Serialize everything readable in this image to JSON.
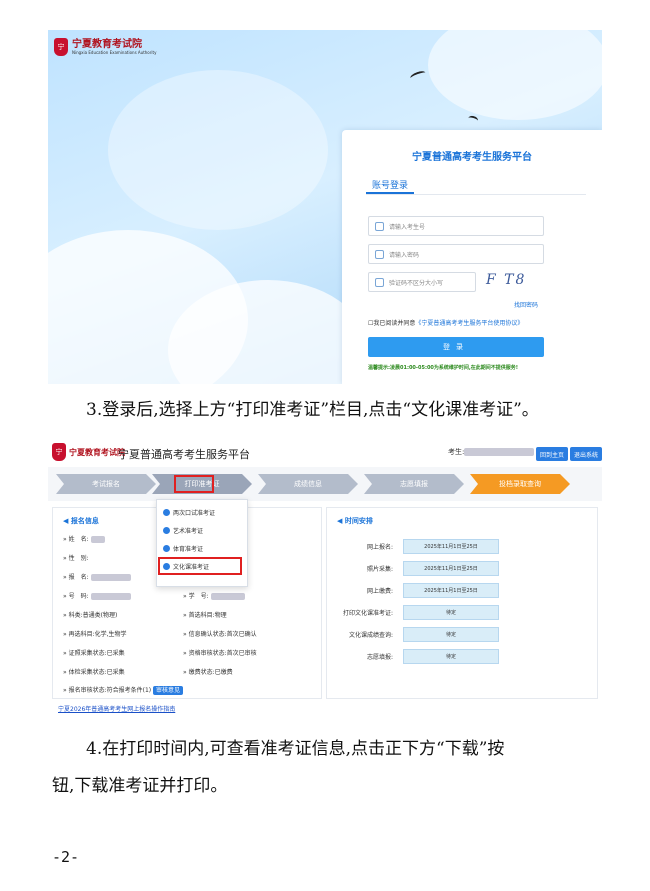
{
  "screenshot1": {
    "logo_text": "宁夏教育考试院",
    "logo_subtext": "Ningxia Education Examinations Authority",
    "login_title": "宁夏普通高考考生服务平台",
    "tab_label": "账号登录",
    "username_placeholder": "请输入考生号",
    "password_placeholder": "请输入密码",
    "captcha_placeholder": "验证码不区分大小写",
    "captcha_text": "F T8",
    "forgot_link": "找回密码",
    "agree_prefix": "我已阅读并同意",
    "agree_link": "《宁夏普通高考考生服务平台使用协议》",
    "login_button": "登录",
    "notice": "温馨提示:凌晨01:00-05:00为系统维护时间,在此期间不提供服务!"
  },
  "step3_text": "3.登录后,选择上方“打印准考证”栏目,点击“文化课准考证”。",
  "screenshot2": {
    "platform_title": "宁夏普通高考考生服务平台",
    "candidate_label": "考生:",
    "btn_home": "回到主页",
    "btn_logout": "退出系统",
    "steps": [
      "考试报名",
      "打印准考证",
      "成绩信息",
      "志愿填报",
      "投档录取查询"
    ],
    "dropdown_items": [
      "两次口试准考证",
      "艺术准考证",
      "体育准考证",
      "文化课准考证"
    ],
    "left_panel_title": "报名信息",
    "left_rows": [
      "姓　名:",
      "性　别:",
      "报　名:",
      "号　码:",
      "科类:普通类(物理)",
      "再选科目:化学,生物学",
      "证照采集状态:已采集",
      "体检采集状态:已采集",
      "报名审核状态:符合报考条件(1)"
    ],
    "left_rows_col2": [
      "学　号:",
      "首选科目:物理",
      "信息确认状态:首次已确认",
      "资格审核状态:首次已审核",
      "缴费状态:已缴费"
    ],
    "review_button": "审核意见",
    "right_panel_title": "时间安排",
    "time_rows": [
      {
        "label": "网上报名:",
        "value": "2025年11月1日至25日"
      },
      {
        "label": "照片采集:",
        "value": "2025年11月1日至25日"
      },
      {
        "label": "网上缴费:",
        "value": "2025年11月1日至25日"
      },
      {
        "label": "打印文化课准考证:",
        "value": "待定"
      },
      {
        "label": "文化课成绩查询:",
        "value": "待定"
      },
      {
        "label": "志愿填报:",
        "value": "待定"
      }
    ],
    "bottom_link": "宁夏2026年普通高考考生网上报名操作指南"
  },
  "step4_line1": "4.在打印时间内,可查看准考证信息,点击正下方“下载”按",
  "step4_line2": "钮,下载准考证并打印。",
  "page_number": "-2-"
}
